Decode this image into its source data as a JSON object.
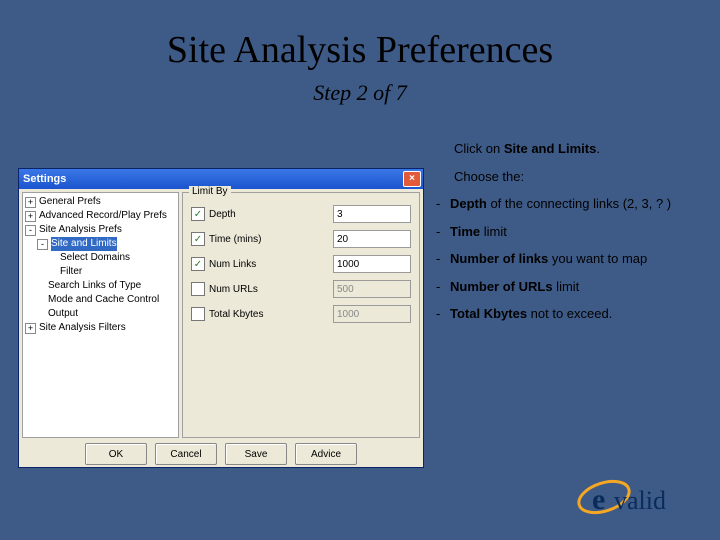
{
  "title": "Site Analysis Preferences",
  "subtitle": "Step 2 of 7",
  "right": {
    "line1_pre": "Click on ",
    "line1_bold": "Site and Limits",
    "line1_post": ".",
    "line2": "Choose the:",
    "bullets": [
      {
        "pre": "Depth",
        "post": " of the connecting links (2, 3, ? )"
      },
      {
        "pre": "Time",
        "post": " limit"
      },
      {
        "pre": "Number of links",
        "post": " you want to map"
      },
      {
        "pre": "Number of URLs",
        "post": " limit"
      },
      {
        "pre": "Total Kbytes",
        "post": " not to exceed."
      }
    ]
  },
  "window": {
    "title": "Settings",
    "close": "×",
    "tree": [
      {
        "lvl": 0,
        "exp": "+",
        "label": "General Prefs"
      },
      {
        "lvl": 0,
        "exp": "+",
        "label": "Advanced Record/Play Prefs"
      },
      {
        "lvl": 0,
        "exp": "-",
        "label": "Site Analysis Prefs"
      },
      {
        "lvl": 1,
        "exp": "-",
        "label": "Site and Limits",
        "sel": true
      },
      {
        "lvl": 2,
        "exp": "",
        "label": "Select Domains"
      },
      {
        "lvl": 2,
        "exp": "",
        "label": "Filter"
      },
      {
        "lvl": 1,
        "exp": "",
        "label": "Search Links of Type"
      },
      {
        "lvl": 1,
        "exp": "",
        "label": "Mode and Cache Control"
      },
      {
        "lvl": 1,
        "exp": "",
        "label": "Output"
      },
      {
        "lvl": 0,
        "exp": "+",
        "label": "Site Analysis Filters"
      }
    ],
    "group_label": "Limit By",
    "rows": [
      {
        "checked": true,
        "label": "Depth",
        "value": "3",
        "enabled": true
      },
      {
        "checked": true,
        "label": "Time (mins)",
        "value": "20",
        "enabled": true
      },
      {
        "checked": true,
        "label": "Num Links",
        "value": "1000",
        "enabled": true
      },
      {
        "checked": false,
        "label": "Num URLs",
        "value": "500",
        "enabled": false
      },
      {
        "checked": false,
        "label": "Total Kbytes",
        "value": "1000",
        "enabled": false
      }
    ],
    "buttons": {
      "ok": "OK",
      "cancel": "Cancel",
      "save": "Save",
      "advice": "Advice"
    }
  },
  "logo_text": "valid"
}
